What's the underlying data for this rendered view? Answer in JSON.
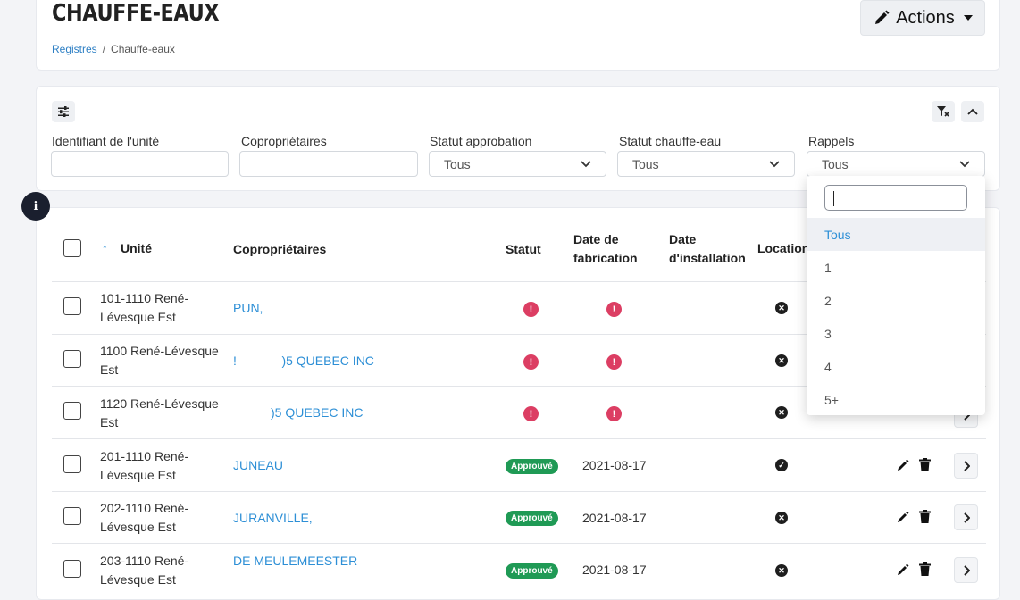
{
  "header": {
    "title": "CHAUFFE-EAUX",
    "breadcrumb": {
      "parent": "Registres",
      "separator": "/",
      "current": "Chauffe-eaux"
    },
    "actions_label": "Actions"
  },
  "filters": {
    "fields": [
      {
        "label": "Identifiant de l'unité",
        "value": ""
      },
      {
        "label": "Copropriétaires",
        "value": ""
      },
      {
        "label": "Statut approbation",
        "value": "Tous"
      },
      {
        "label": "Statut chauffe-eau",
        "value": "Tous"
      },
      {
        "label": "Rappels",
        "value": "Tous"
      }
    ]
  },
  "rappels_dropdown": {
    "search_value": "",
    "options": [
      "Tous",
      "1",
      "2",
      "3",
      "4",
      "5+"
    ],
    "selected": "Tous"
  },
  "table": {
    "columns": {
      "sort_arrow": "↑",
      "unite": "Unité",
      "coproprietaires": "Copropriétaires",
      "statut": "Statut",
      "date_fabrication": "Date de fabrication",
      "date_installation": "Date d'installation",
      "location": "Location"
    },
    "rows": [
      {
        "unite": "101-1110 René-Lévesque Est",
        "coproprietaires": "PUN,",
        "statut": "alert",
        "date_fabrication": "alert",
        "location": "x"
      },
      {
        "unite": "1100 René-Lévesque Est",
        "coproprietaires": "!             )5 QUEBEC INC",
        "statut": "alert",
        "date_fabrication": "alert",
        "location": "x"
      },
      {
        "unite": "1120 René-Lévesque Est",
        "coproprietaires": ")5 QUEBEC INC",
        "statut": "alert",
        "date_fabrication": "alert",
        "location": "x"
      },
      {
        "unite": "201-1110 René-Lévesque Est",
        "coproprietaires": "JUNEAU",
        "statut": "Approuvé",
        "date_fabrication": "2021-08-17",
        "location": "check"
      },
      {
        "unite": "202-1110 René-Lévesque Est",
        "coproprietaires": "JURANVILLE,",
        "statut": "Approuvé",
        "date_fabrication": "2021-08-17",
        "location": "x"
      },
      {
        "unite": "203-1110 René-Lévesque Est",
        "coproprietaires": "DE MEULEMEESTER",
        "statut": "Approuvé",
        "date_fabrication": "2021-08-17",
        "location": "x"
      }
    ]
  },
  "colors": {
    "link": "#2d8fd6",
    "alert": "#dc3e63",
    "approved": "#1f9a55",
    "info_dot": "#1a1f2e"
  }
}
